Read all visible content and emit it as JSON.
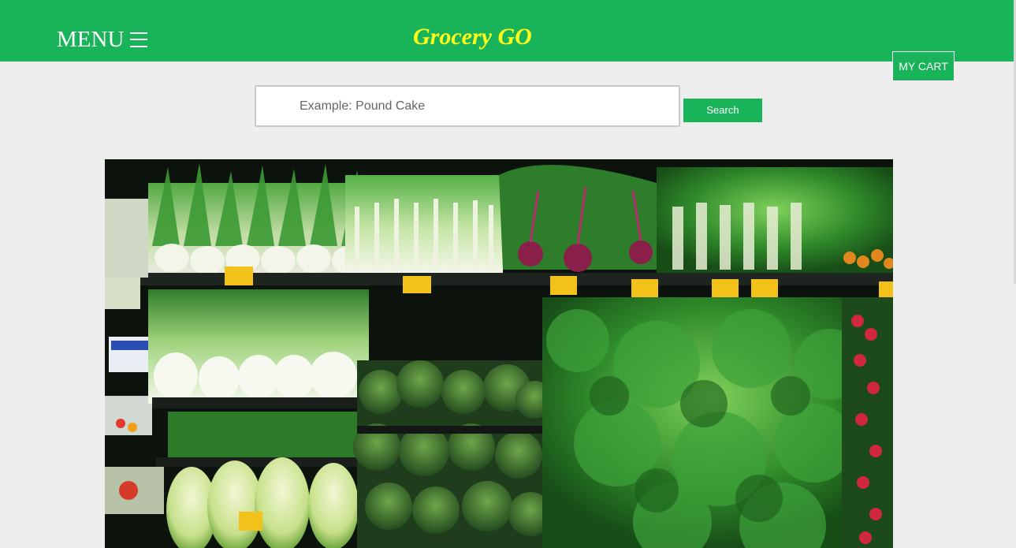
{
  "header": {
    "menu_label": "MENU",
    "menu_icon": "hamburger-icon",
    "brand": "Grocery GO",
    "cart_label": "MY CART",
    "colors": {
      "bar": "#19b35a",
      "brand_text": "#ffff1a"
    }
  },
  "search": {
    "placeholder": "Example: Pound Cake",
    "value": "",
    "button_label": "Search"
  },
  "hero": {
    "image": "produce-shelves-photo"
  }
}
